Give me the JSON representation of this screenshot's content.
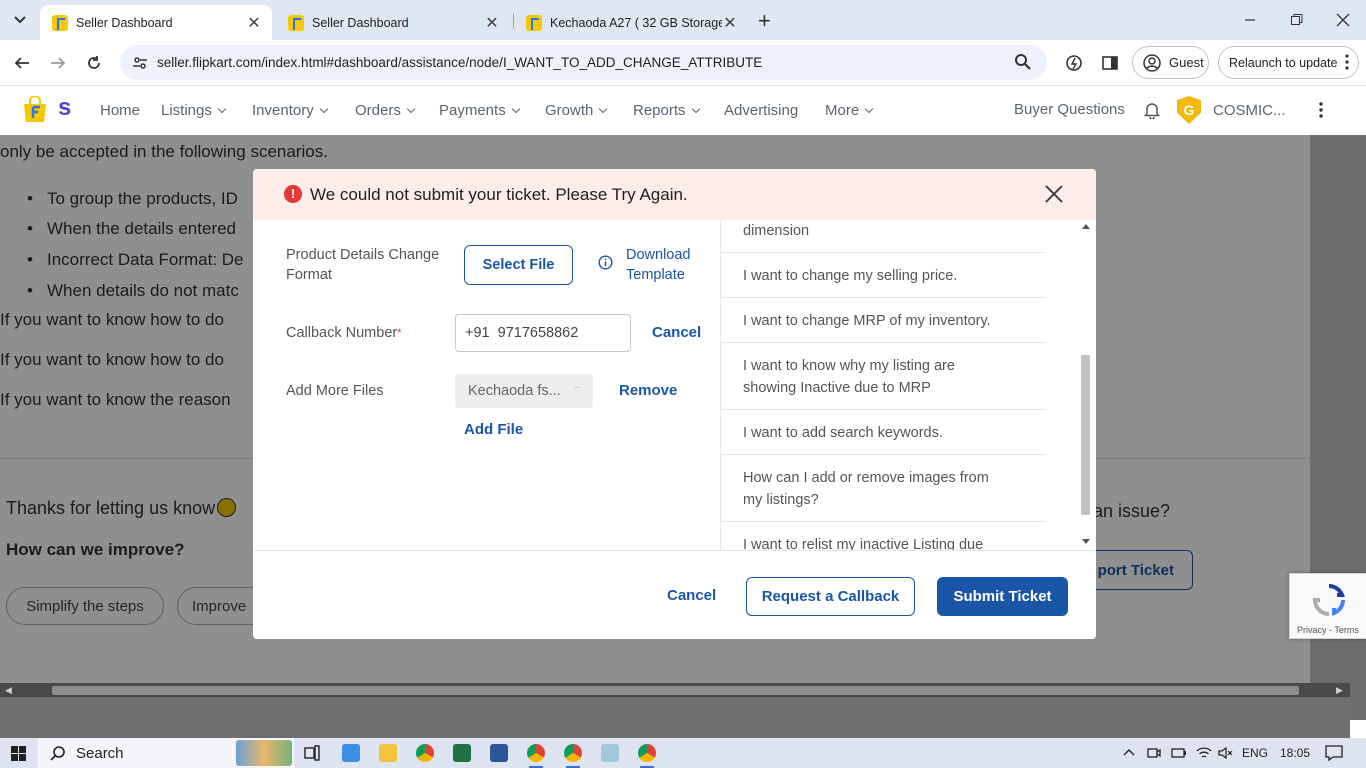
{
  "browser": {
    "tabs": [
      {
        "title": "Seller Dashboard",
        "active": true
      },
      {
        "title": "Seller Dashboard",
        "active": false
      },
      {
        "title": "Kechaoda A27 ( 32 GB Storage,",
        "active": false
      }
    ],
    "url": "seller.flipkart.com/index.html#dashboard/assistance/node/I_WANT_TO_ADD_CHANGE_ATTRIBUTE",
    "guest_label": "Guest",
    "relaunch_label": "Relaunch to update"
  },
  "nav": {
    "logo_letter": "s",
    "items": [
      "Home",
      "Listings",
      "Inventory",
      "Orders",
      "Payments",
      "Growth",
      "Reports",
      "Advertising",
      "More"
    ],
    "buyer_questions": "Buyer Questions",
    "avatar_letter": "G",
    "account_name": "COSMIC..."
  },
  "background": {
    "intro": "only be accepted in the following scenarios.",
    "bullets": [
      "To group the products, ID",
      "When the details entered",
      "Incorrect Data Format: De",
      "When details do not matc"
    ],
    "lines": [
      "If you want to know how to do",
      "If you want to know how to do",
      "If you want to know the reason"
    ],
    "thanks": "Thanks for letting us know",
    "improve_q": "How can we improve?",
    "chip1": "Simplify the steps",
    "chip2": "Improve",
    "right_q": "an issue?",
    "right_btn": "port Ticket",
    "recaptcha_links": "Privacy - Terms"
  },
  "modal": {
    "error": "We could not submit your ticket. Please Try Again.",
    "product_details_label": "Product Details Change Format",
    "select_file": "Select File",
    "download_template": "Download Template",
    "callback_label": "Callback Number",
    "required_mark": "*",
    "phone_prefix": "+91",
    "phone_number": "9717658862",
    "cancel_inline": "Cancel",
    "add_more_label": "Add More Files",
    "file_name": "Kechaoda fs...",
    "remove": "Remove",
    "add_file": "Add File",
    "list_items": [
      "dimension",
      "I want to change my selling price.",
      "I want to change MRP of my inventory.",
      "I want to know why my listing are showing Inactive due to MRP",
      "I want to add search keywords.",
      "How can I add or remove images from my listings?",
      "I want to relist my inactive Listing due"
    ],
    "footer": {
      "cancel": "Cancel",
      "callback": "Request a Callback",
      "submit": "Submit Ticket"
    }
  },
  "taskbar": {
    "search": "Search",
    "lang": "ENG",
    "time": "18:05"
  },
  "colors": {
    "primary_blue": "#1a56a8",
    "error_red": "#e53935",
    "error_bg": "#fdecea",
    "flipkart_yellow": "#f7c800"
  }
}
